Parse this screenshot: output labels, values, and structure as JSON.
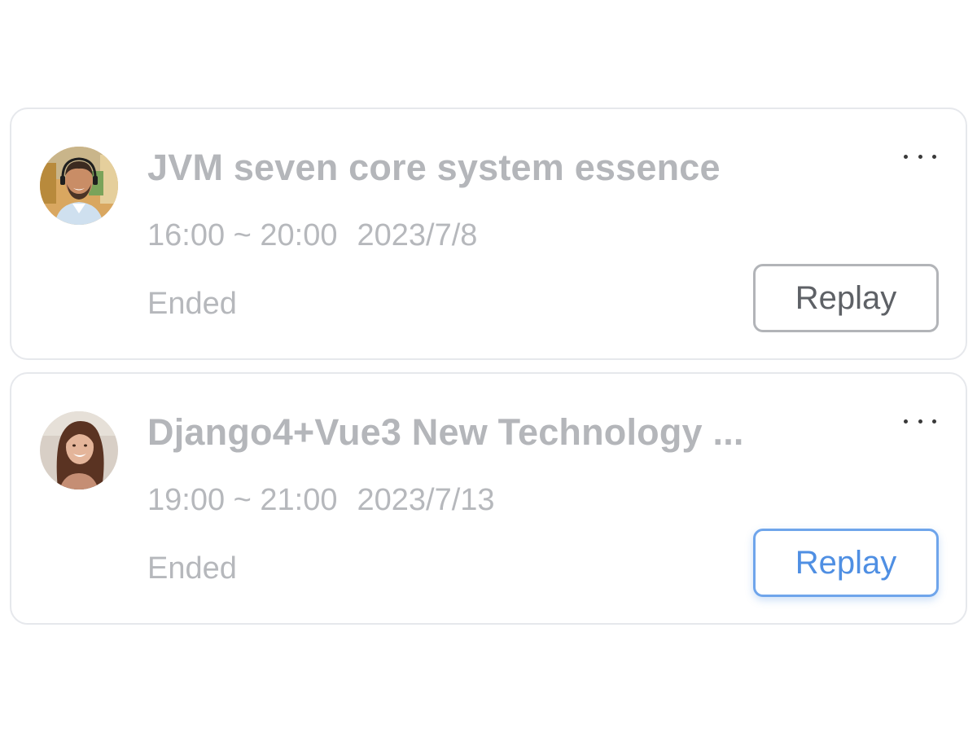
{
  "sessions": [
    {
      "title": "JVM seven core system essence",
      "time_range": "16:00 ~ 20:00",
      "date": "2023/7/8",
      "status": "Ended",
      "action_label": "Replay",
      "avatar": "male-host-avatar",
      "more_icon": "ellipsis-icon"
    },
    {
      "title": "Django4+Vue3 New Technology ...",
      "time_range": "19:00 ~ 21:00",
      "date": "2023/7/13",
      "status": "Ended",
      "action_label": "Replay",
      "avatar": "female-host-avatar",
      "more_icon": "ellipsis-icon"
    }
  ],
  "colors": {
    "title": "#b4b6ba",
    "meta": "#b6b8bc",
    "card_border": "#e6e8ec",
    "button_border": "#b2b4b8",
    "button_text": "#5e6166",
    "button_active": "#4f8fe3"
  }
}
